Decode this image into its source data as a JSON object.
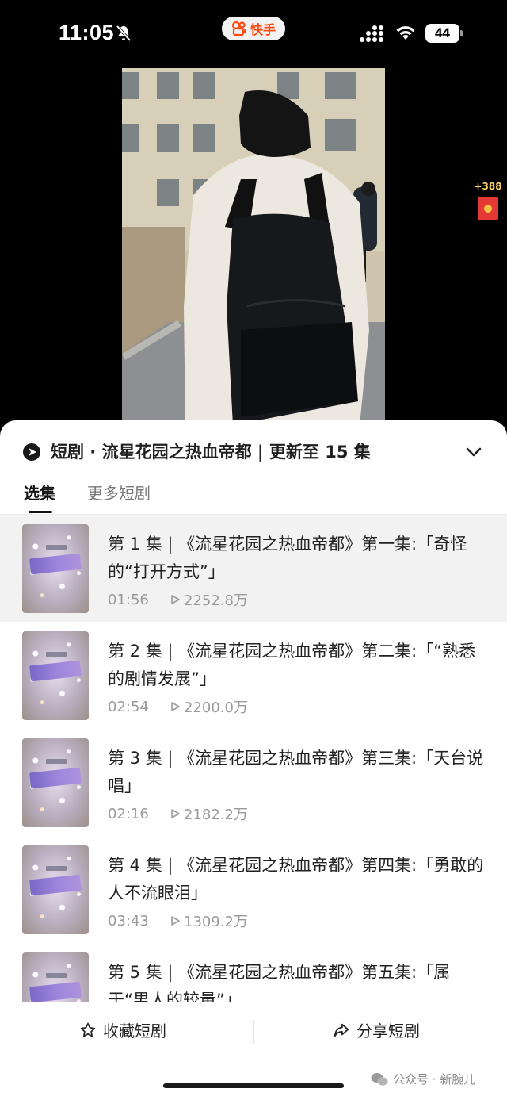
{
  "status_bar": {
    "time": "11:05",
    "app_name": "快手",
    "battery": "44"
  },
  "reward": {
    "count": "+388"
  },
  "sheet": {
    "title": "短剧 · 流星花园之热血帝都 | 更新至 15 集",
    "tabs": [
      "选集",
      "更多短剧"
    ],
    "episodes": [
      {
        "title": "第 1 集 | 《流星花园之热血帝都》第一集:「奇怪的“打开方式”」",
        "duration": "01:56",
        "views": "2252.8万",
        "current": true
      },
      {
        "title": "第 2 集 | 《流星花园之热血帝都》第二集:「“熟悉的剧情发展”」",
        "duration": "02:54",
        "views": "2200.0万",
        "current": false
      },
      {
        "title": "第 3 集 | 《流星花园之热血帝都》第三集:「天台说唱」",
        "duration": "02:16",
        "views": "2182.2万",
        "current": false
      },
      {
        "title": "第 4 集 | 《流星花园之热血帝都》第四集:「勇敢的人不流眼泪」",
        "duration": "03:43",
        "views": "1309.2万",
        "current": false
      },
      {
        "title": "第 5 集 | 《流星花园之热血帝都》第五集:「属于“男人的较量”」",
        "duration": "",
        "views": "",
        "current": false
      }
    ]
  },
  "bottom_bar": {
    "favorite_label": "收藏短剧",
    "share_label": "分享短剧"
  },
  "watermark": "公众号 · 新腕儿",
  "colors": {
    "accent": "#ff4a0d",
    "reward": "#e53935"
  }
}
